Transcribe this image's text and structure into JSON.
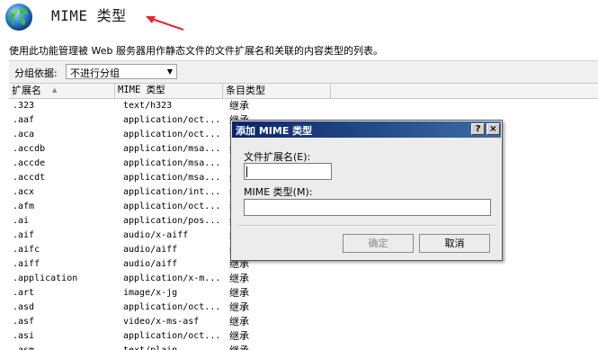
{
  "header": {
    "title": "MIME 类型",
    "description": "使用此功能管理被 Web 服务器用作静态文件的文件扩展名和关联的内容类型的列表。"
  },
  "groupbar": {
    "label": "分组依据:",
    "selected": "不进行分组"
  },
  "grid": {
    "columns": [
      "扩展名",
      "MIME 类型",
      "条目类型"
    ],
    "rows": [
      [
        ".323",
        "text/h323",
        "继承"
      ],
      [
        ".aaf",
        "application/oct...",
        "继承"
      ],
      [
        ".aca",
        "application/oct...",
        "继承"
      ],
      [
        ".accdb",
        "application/msa...",
        "继承"
      ],
      [
        ".accde",
        "application/msa...",
        "继承"
      ],
      [
        ".accdt",
        "application/msa...",
        "继承"
      ],
      [
        ".acx",
        "application/int...",
        "继承"
      ],
      [
        ".afm",
        "application/oct...",
        "继承"
      ],
      [
        ".ai",
        "application/pos...",
        "继承"
      ],
      [
        ".aif",
        "audio/x-aiff",
        "继承"
      ],
      [
        ".aifc",
        "audio/aiff",
        "继承"
      ],
      [
        ".aiff",
        "audio/aiff",
        "继承"
      ],
      [
        ".application",
        "application/x-m...",
        "继承"
      ],
      [
        ".art",
        "image/x-jg",
        "继承"
      ],
      [
        ".asd",
        "application/oct...",
        "继承"
      ],
      [
        ".asf",
        "video/x-ms-asf",
        "继承"
      ],
      [
        ".asi",
        "application/oct...",
        "继承"
      ],
      [
        ".asm",
        "text/plain",
        "继承"
      ]
    ]
  },
  "dialog": {
    "title": "添加 MIME 类型",
    "help_label": "?",
    "close_label": "×",
    "ext_label": "文件扩展名(E):",
    "ext_value": "",
    "mime_label": "MIME 类型(M):",
    "mime_value": "",
    "ok_label": "确定",
    "cancel_label": "取消"
  },
  "colors": {
    "title_bar_start": "#0a246a",
    "title_bar_end": "#3a6ea5",
    "annotation_arrow": "#e8262a"
  },
  "icons": {
    "page": "globe-icon",
    "annotation": "red-arrow-icon",
    "sort": "sort-ascending-icon"
  }
}
